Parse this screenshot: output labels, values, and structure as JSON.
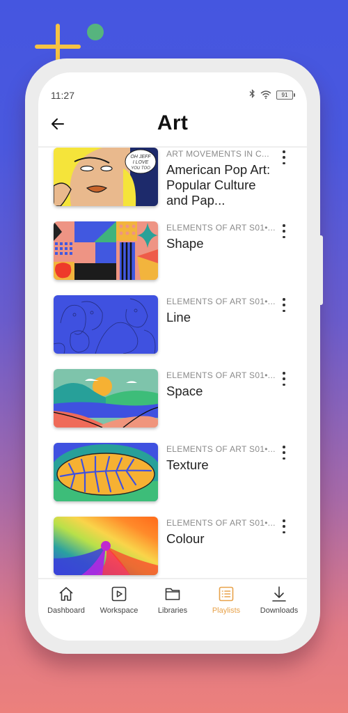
{
  "status_bar": {
    "time": "11:27",
    "battery": "91"
  },
  "header": {
    "title": "Art",
    "back_icon": "arrow-left-icon"
  },
  "playlist_items": [
    {
      "category": "ART MOVEMENTS IN C...",
      "title": "American Pop Art: Popular Culture and Pap...",
      "thumbnail": "pop-art-comic-woman",
      "speech_bubble": "OH JEFF... I LOVE YOU TOO BUT..."
    },
    {
      "category": "ELEMENTS OF ART S01•...",
      "title": "Shape",
      "thumbnail": "geometric-shapes"
    },
    {
      "category": "ELEMENTS OF ART S01•...",
      "title": "Line",
      "thumbnail": "line-drawn-faces"
    },
    {
      "category": "ELEMENTS OF ART S01•...",
      "title": "Space",
      "thumbnail": "landscape-hills-sun"
    },
    {
      "category": "ELEMENTS OF ART S01•...",
      "title": "Texture",
      "thumbnail": "leaf-texture"
    },
    {
      "category": "ELEMENTS OF ART S01•...",
      "title": "Colour",
      "thumbnail": "color-spiral"
    }
  ],
  "bottom_nav": {
    "items": [
      {
        "label": "Dashboard",
        "icon": "home-icon",
        "active": false
      },
      {
        "label": "Workspace",
        "icon": "play-square-icon",
        "active": false
      },
      {
        "label": "Libraries",
        "icon": "folder-icon",
        "active": false
      },
      {
        "label": "Playlists",
        "icon": "list-icon",
        "active": true
      },
      {
        "label": "Downloads",
        "icon": "download-icon",
        "active": false
      }
    ]
  },
  "colors": {
    "accent": "#e8a24a",
    "background_top": "#4556e0",
    "background_bottom": "#ec807c"
  }
}
